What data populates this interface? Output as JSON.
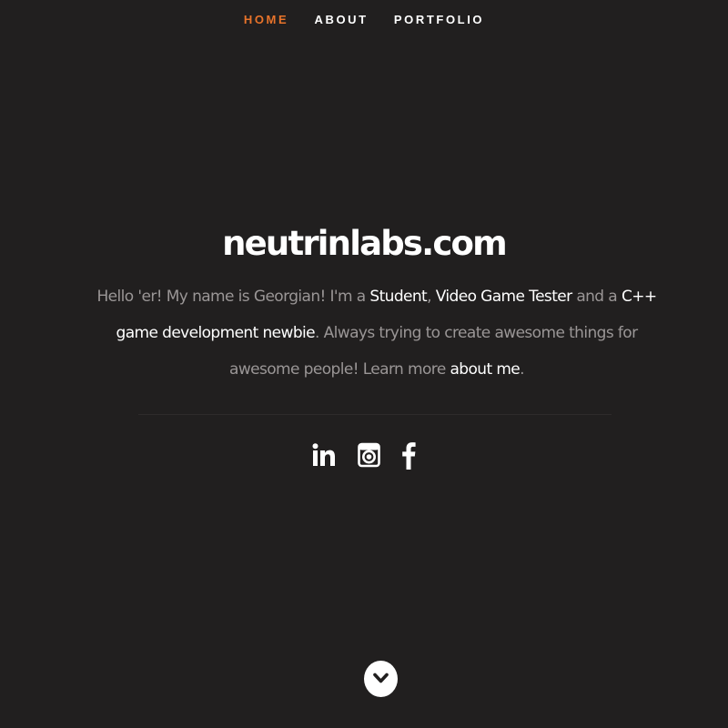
{
  "nav": {
    "items": [
      {
        "label": "HOME",
        "active": true
      },
      {
        "label": "ABOUT",
        "active": false
      },
      {
        "label": "PORTFOLIO",
        "active": false
      }
    ]
  },
  "hero": {
    "title": "neutrinlabs.com",
    "intro": {
      "t1": "Hello 'er! My name is Georgian! I'm a ",
      "l1": "Student",
      "t2": ", ",
      "l2": "Video Game Tester",
      "t3": " and a ",
      "l3": "C++ game development newbie",
      "t4": ". Always trying to create awesome things for awesome people! Learn more ",
      "l4": "about me",
      "t5": "."
    }
  },
  "social": {
    "icons": [
      "linkedin-icon",
      "instagram-icon",
      "facebook-icon"
    ]
  },
  "colors": {
    "background": "#211f1f",
    "accent": "#e8732a",
    "text": "#ffffff",
    "muted": "#9a9696"
  }
}
